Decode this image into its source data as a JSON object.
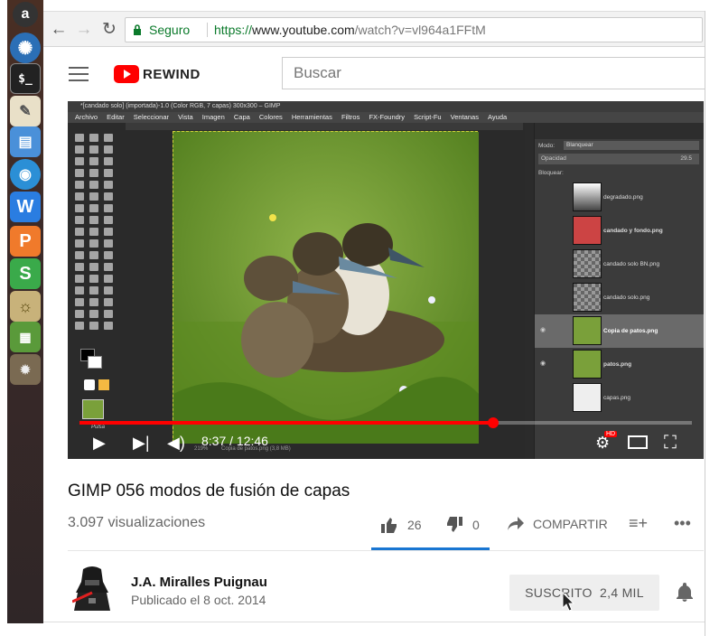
{
  "browser": {
    "security_label": "Seguro",
    "url_scheme": "https://",
    "url_host": "www.youtube.com",
    "url_path": "/watch?v=vl964a1FFtM"
  },
  "youtube": {
    "logo_text": "REWIND",
    "search_placeholder": "Buscar"
  },
  "gimp": {
    "window_title": "*[candado solo] (importada)-1.0 (Color RGB, 7 capas) 300x300 – GIMP",
    "menu": [
      "Archivo",
      "Editar",
      "Seleccionar",
      "Vista",
      "Imagen",
      "Capa",
      "Colores",
      "Herramientas",
      "Filtros",
      "FX-Foundry",
      "Script-Fu",
      "Ventanas",
      "Ayuda"
    ],
    "mode_label": "Modo:",
    "mode_value": "Blanquear",
    "opacity_label": "Opacidad",
    "opacity_value": "29.5",
    "lock_label": "Bloquear:",
    "layers": [
      {
        "name": "degradado.png"
      },
      {
        "name": "candado y fondo.png"
      },
      {
        "name": "candado solo BN.png"
      },
      {
        "name": "candado solo.png"
      },
      {
        "name": "Copia de patos.png"
      },
      {
        "name": "patos.png"
      },
      {
        "name": "capas.png"
      }
    ],
    "status": "Copia de patos.png (3,8 MB)",
    "zoom": "219%",
    "tool_label": "Pulsa"
  },
  "player": {
    "current_time": "8:37",
    "duration": "12:46",
    "progress_fraction": 0.675,
    "hd_badge": "HD"
  },
  "video": {
    "title": "GIMP 056 modos de fusión de capas",
    "views": "3.097 visualizaciones",
    "likes": "26",
    "dislikes": "0",
    "share_label": "COMPARTIR"
  },
  "channel": {
    "name": "J.A. Miralles Puignau",
    "published": "Publicado el 8 oct. 2014",
    "subscribe_label": "SUSCRITO",
    "subscriber_count": "2,4 MIL"
  },
  "colors": {
    "accent_red": "#ff0000",
    "secure_green": "#0b7a2b",
    "like_underline": "#1976d2"
  }
}
